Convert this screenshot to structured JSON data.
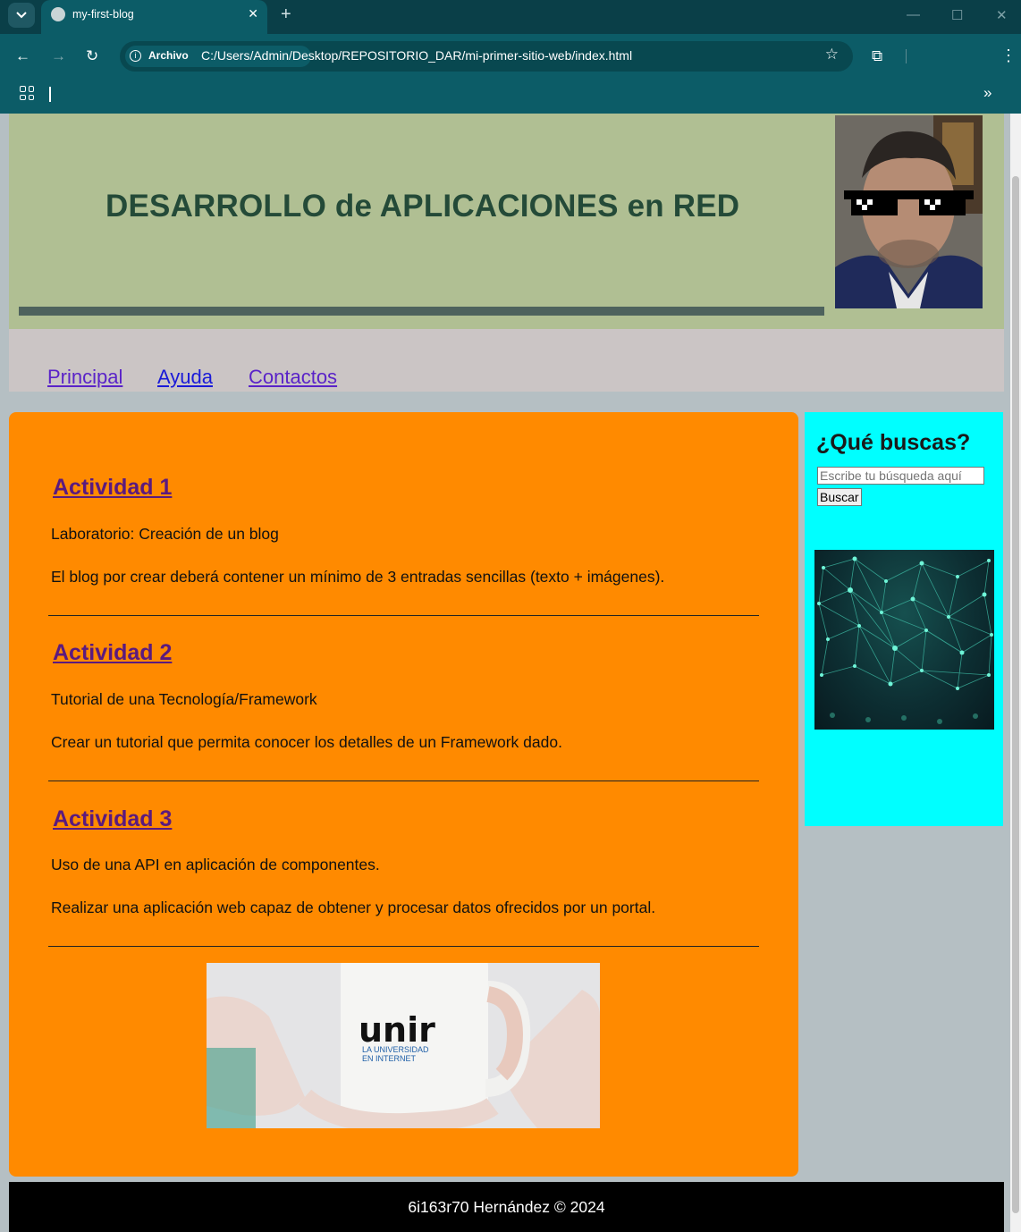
{
  "browser": {
    "tab_title": "my-first-blog",
    "new_tab_label": "+",
    "security_chip": "Archivo",
    "url": "C:/Users/Admin/Desktop/REPOSITORIO_DAR/mi-primer-sitio-web/index.html",
    "theme_color": "#0c5c67"
  },
  "header": {
    "title": "DESARROLLO de APLICACIONES en RED",
    "background": "#b0bf93"
  },
  "nav": {
    "items": [
      {
        "label": "Principal"
      },
      {
        "label": "Ayuda"
      },
      {
        "label": "Contactos"
      }
    ]
  },
  "main": {
    "background": "#ff8a00",
    "activities": [
      {
        "title": "Actividad 1",
        "subtitle": "Laboratorio: Creación de un blog",
        "description": "El blog por crear deberá contener un mínimo de 3 entradas sencillas (texto + imágenes)."
      },
      {
        "title": "Actividad 2",
        "subtitle": "Tutorial de una Tecnología/Framework",
        "description": "Crear un tutorial que permita conocer los detalles de un Framework dado."
      },
      {
        "title": "Actividad 3",
        "subtitle": "Uso de una API en aplicación de componentes.",
        "description": "Realizar una aplicación web capaz de obtener y procesar datos ofrecidos por un portal."
      }
    ],
    "mug": {
      "brand": "unir",
      "tagline_1": "LA UNIVERSIDAD",
      "tagline_2": "EN INTERNET"
    }
  },
  "aside": {
    "title": "¿Qué buscas?",
    "search_placeholder": "Escribe tu búsqueda aquí",
    "search_button": "Buscar",
    "background": "#00ffff"
  },
  "footer": {
    "text": "6i163r70 Hernández © 2024"
  }
}
